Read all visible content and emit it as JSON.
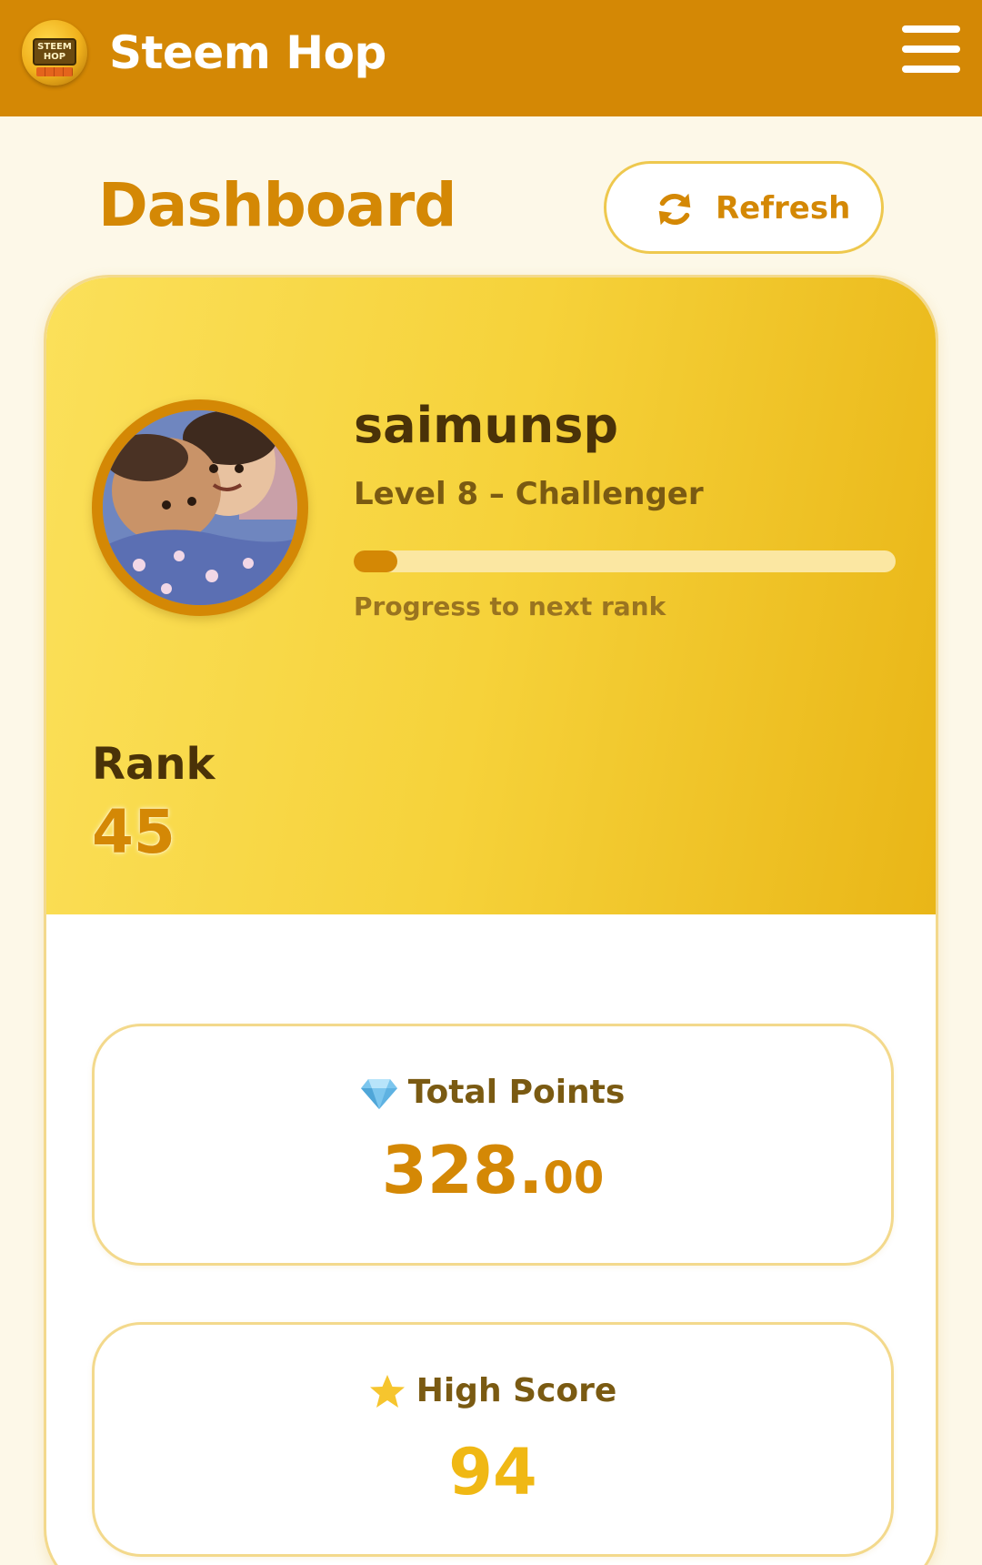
{
  "header": {
    "logo_text_line1": "STEEM",
    "logo_text_line2": "HOP",
    "app_title": "Steem Hop",
    "menu_icon": "hamburger-menu-icon"
  },
  "page": {
    "title": "Dashboard",
    "refresh_label": "Refresh",
    "refresh_icon": "refresh-icon"
  },
  "profile": {
    "username": "saimunsp",
    "level_text": "Level 8 – Challenger",
    "progress_fraction": 0.08,
    "progress_caption": "Progress to next rank",
    "rank_label": "Rank",
    "rank_value": "45"
  },
  "stats": {
    "total_points_icon": "diamond-icon",
    "total_points_label": "Total Points",
    "total_points_int": "328.",
    "total_points_dec": "00",
    "high_score_icon": "star-icon",
    "high_score_label": "High Score",
    "high_score_value": "94"
  },
  "colors": {
    "brand": "#d48805",
    "hero_start": "#fbe05a",
    "hero_end": "#e9b617",
    "page_bg": "#fdf8e8",
    "score_yellow": "#f0b814"
  }
}
